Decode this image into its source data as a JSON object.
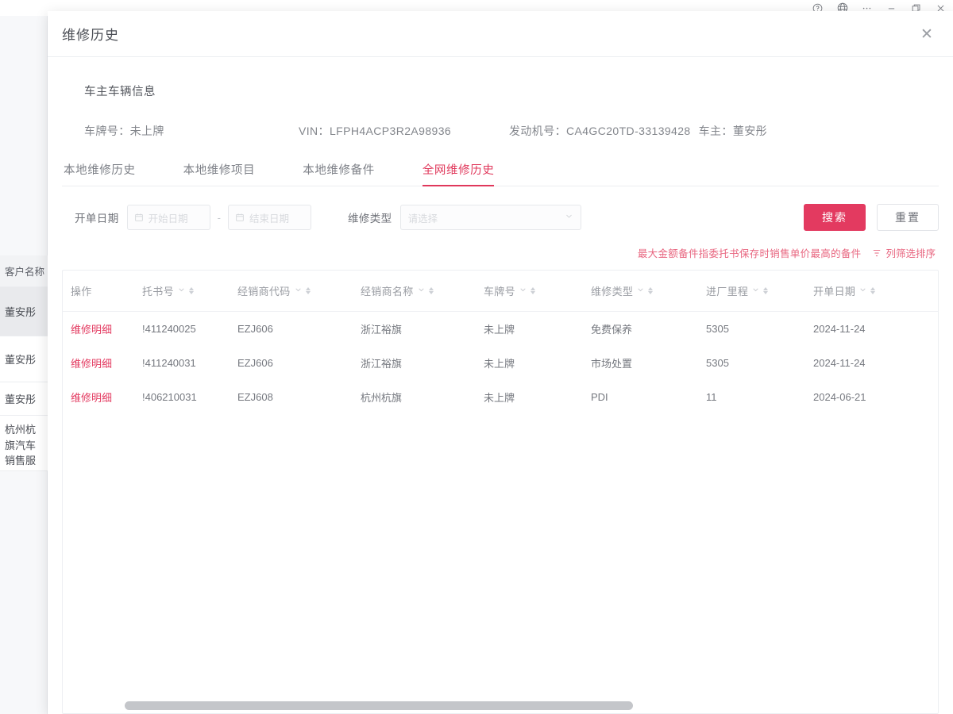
{
  "toolbar": {
    "icons": [
      "help-icon",
      "globe-icon",
      "more-icon",
      "minimize-icon",
      "restore-icon",
      "close-icon"
    ]
  },
  "background": {
    "column_header": "客户名称",
    "rows": [
      "董安彤",
      "董安彤",
      "董安彤",
      "杭州杭旗汽车销售服务有限公司"
    ]
  },
  "modal": {
    "title": "维修历史",
    "close_label": "✕"
  },
  "vehicle": {
    "section_title": "车主车辆信息",
    "plate_label": "车牌号：",
    "plate_value": "未上牌",
    "vin_label": "VIN：",
    "vin_value": "LFPH4ACP3R2A98936",
    "engine_label": "发动机号：",
    "engine_value": "CA4GC20TD-33139428",
    "owner_label": "车主：",
    "owner_value": "董安彤"
  },
  "tabs": [
    {
      "label": "本地维修历史",
      "active": false
    },
    {
      "label": "本地维修项目",
      "active": false
    },
    {
      "label": "本地维修备件",
      "active": false
    },
    {
      "label": "全网维修历史",
      "active": true
    }
  ],
  "filters": {
    "date_label": "开单日期",
    "date_start_placeholder": "开始日期",
    "date_end_placeholder": "结束日期",
    "date_separator": "-",
    "type_label": "维修类型",
    "type_placeholder": "请选择",
    "search_button": "搜索",
    "reset_button": "重置"
  },
  "note": {
    "text": "最大金额备件指委托书保存时销售单价最高的备件",
    "action": "列筛选排序"
  },
  "table": {
    "columns": [
      {
        "key": "op",
        "label": "操作",
        "sortable": false,
        "filterable": false
      },
      {
        "key": "note",
        "label": "托书号",
        "sortable": true,
        "filterable": true
      },
      {
        "key": "code",
        "label": "经销商代码",
        "sortable": true,
        "filterable": true
      },
      {
        "key": "name",
        "label": "经销商名称",
        "sortable": true,
        "filterable": true
      },
      {
        "key": "plate",
        "label": "车牌号",
        "sortable": true,
        "filterable": true
      },
      {
        "key": "type",
        "label": "维修类型",
        "sortable": true,
        "filterable": true
      },
      {
        "key": "mile",
        "label": "进厂里程",
        "sortable": true,
        "filterable": true
      },
      {
        "key": "date",
        "label": "开单日期",
        "sortable": true,
        "filterable": true
      }
    ],
    "row_action_label": "维修明细",
    "rows": [
      {
        "op": "维修明细",
        "note": "!411240025",
        "code": "EZJ606",
        "name": "浙江裕旗",
        "plate": "未上牌",
        "type": "免费保养",
        "mile": "5305",
        "date": "2024-11-24"
      },
      {
        "op": "维修明细",
        "note": "!411240031",
        "code": "EZJ606",
        "name": "浙江裕旗",
        "plate": "未上牌",
        "type": "市场处置",
        "mile": "5305",
        "date": "2024-11-24"
      },
      {
        "op": "维修明细",
        "note": "!406210031",
        "code": "EZJ608",
        "name": "杭州杭旗",
        "plate": "未上牌",
        "type": "PDI",
        "mile": "11",
        "date": "2024-06-21"
      }
    ]
  },
  "colors": {
    "accent": "#e33a60",
    "note": "#e8657f",
    "text": "#75787f",
    "muted": "#9a9da3",
    "border": "#edeff2"
  }
}
